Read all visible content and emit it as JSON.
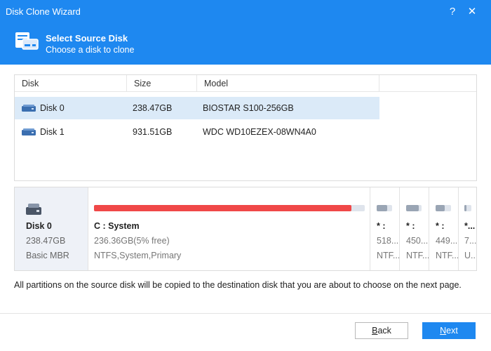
{
  "window": {
    "title": "Disk Clone Wizard",
    "help_glyph": "?",
    "close_glyph": "✕"
  },
  "header": {
    "title": "Select Source Disk",
    "subtitle": "Choose a disk to clone",
    "icon": "disk-clone-icon"
  },
  "table": {
    "columns": [
      "Disk",
      "Size",
      "Model"
    ],
    "rows": [
      {
        "disk": "Disk 0",
        "size": "238.47GB",
        "model": "BIOSTAR S100-256GB",
        "selected": true
      },
      {
        "disk": "Disk 1",
        "size": "931.51GB",
        "model": "WDC WD10EZEX-08WN4A0",
        "selected": false
      }
    ]
  },
  "layout": {
    "disk": {
      "name": "Disk 0",
      "size": "238.47GB",
      "type": "Basic MBR"
    },
    "partitions": [
      {
        "name": "C : System",
        "free": "236.36GB(5% free)",
        "fs": "NTFS,System,Primary",
        "used_fraction": 0.95
      },
      {
        "name": "* :",
        "free": "518...",
        "fs": "NTF...",
        "used_fraction": 0.7
      },
      {
        "name": "* :",
        "free": "450...",
        "fs": "NTF...",
        "used_fraction": 0.8
      },
      {
        "name": "* :",
        "free": "449...",
        "fs": "NTF...",
        "used_fraction": 0.6
      },
      {
        "name": "*...",
        "free": "7...",
        "fs": "U...",
        "used_fraction": 0.3
      }
    ]
  },
  "note": "All partitions on the source disk will be copied to the destination disk that you are about to choose on the next page.",
  "buttons": {
    "back_first": "B",
    "back_rest": "ack",
    "next_first": "N",
    "next_rest": "ext"
  },
  "colors": {
    "accent": "#1e88f0",
    "used_bar": "#f04848",
    "selected_row": "#dbeaf8"
  }
}
